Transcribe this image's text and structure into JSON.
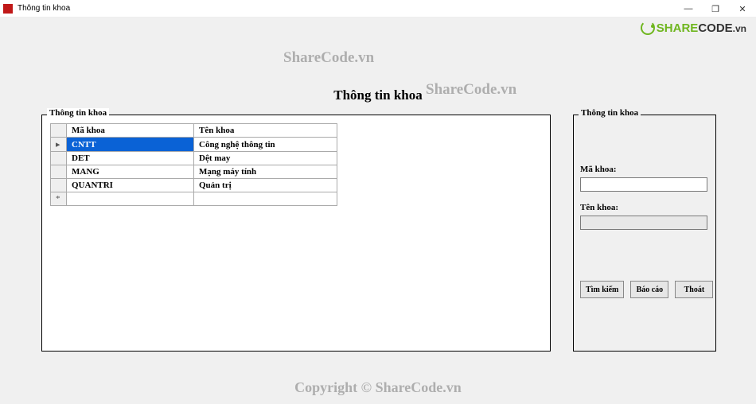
{
  "window": {
    "title": "Thông tin khoa",
    "controls": {
      "min": "—",
      "max": "❐",
      "close": "✕"
    }
  },
  "logo": {
    "brand_share": "SHARE",
    "brand_code": "CODE",
    "tld": ".vn"
  },
  "watermarks": {
    "top": "ShareCode.vn",
    "mid": "ShareCode.vn",
    "footer": "Copyright © ShareCode.vn"
  },
  "heading": "Thông tin khoa",
  "left_group": {
    "legend": "Thông tin khoa",
    "columns": {
      "ma": "Mã khoa",
      "ten": "Tên khoa"
    },
    "rows": [
      {
        "ma": "CNTT",
        "ten": "Công nghệ thông tin",
        "selected": true
      },
      {
        "ma": "DET",
        "ten": "Dệt may"
      },
      {
        "ma": "MANG",
        "ten": "Mạng máy tính"
      },
      {
        "ma": "QUANTRI",
        "ten": "Quản trị"
      }
    ],
    "row_indicator": "▸",
    "new_row_indicator": "*"
  },
  "right_group": {
    "legend": "Thông tin khoa",
    "ma_label": "Mã khoa:",
    "ma_value": "",
    "ten_label": "Tên khoa:",
    "ten_value": "",
    "buttons": {
      "search": "Tìm kiếm",
      "report": "Báo cáo",
      "exit": "Thoát"
    }
  }
}
